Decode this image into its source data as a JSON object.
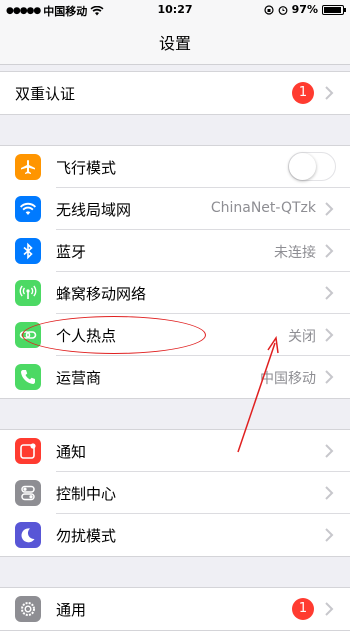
{
  "status": {
    "carrier": "中国移动",
    "time": "10:27",
    "battery_percent": "97%",
    "battery_level": 0.97
  },
  "nav": {
    "title": "设置"
  },
  "rows": {
    "two_factor": {
      "label": "双重认证",
      "badge": "1"
    },
    "airplane": {
      "label": "飞行模式",
      "toggle_on": false
    },
    "wifi": {
      "label": "无线局域网",
      "value": "ChinaNet-QTzk"
    },
    "bluetooth": {
      "label": "蓝牙",
      "value": "未连接"
    },
    "cellular": {
      "label": "蜂窝移动网络"
    },
    "hotspot": {
      "label": "个人热点",
      "value": "关闭"
    },
    "carrier": {
      "label": "运营商",
      "value": "中国移动"
    },
    "notifications": {
      "label": "通知"
    },
    "control_center": {
      "label": "控制中心"
    },
    "dnd": {
      "label": "勿扰模式"
    },
    "general": {
      "label": "通用",
      "badge": "1"
    }
  },
  "colors": {
    "airplane": "#ff9500",
    "wifi": "#007aff",
    "bluetooth": "#007aff",
    "cellular": "#4cd964",
    "hotspot": "#4cd964",
    "carrier": "#4cd964",
    "notifications": "#ff3b30",
    "control_center": "#8e8e93",
    "dnd": "#5856d6",
    "general": "#8e8e93",
    "annotation": "#e02020"
  }
}
